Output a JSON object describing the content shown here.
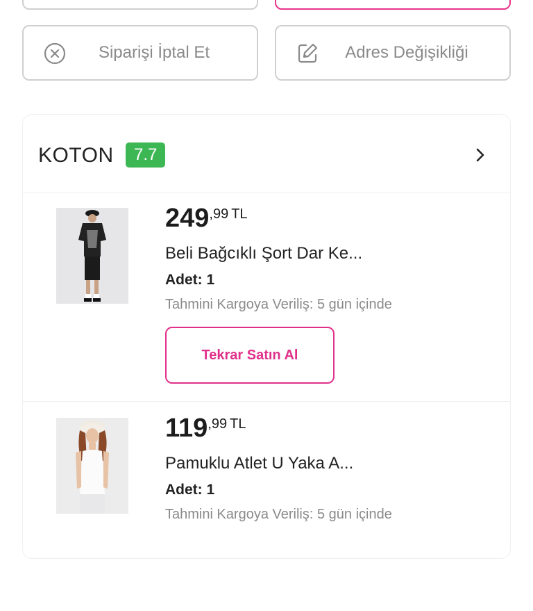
{
  "top_actions": {
    "cancel_order": {
      "label": "Siparişi İptal Et",
      "icon": "circle-x-icon"
    },
    "address_change": {
      "label": "Adres Değişikliği",
      "icon": "edit-icon"
    }
  },
  "seller": {
    "name": "KOTON",
    "score": "7.7",
    "score_color": "#3db754"
  },
  "items": [
    {
      "price_int": "249",
      "price_dec": ",99",
      "currency": "TL",
      "name": "Beli Bağcıklı Şort Dar Ke...",
      "quantity": "Adet: 1",
      "shipping": "Tahmini Kargoya Veriliş: 5 gün içinde",
      "rebuy_label": "Tekrar Satın Al"
    },
    {
      "price_int": "119",
      "price_dec": ",99",
      "currency": "TL",
      "name": "Pamuklu Atlet U Yaka A...",
      "quantity": "Adet: 1",
      "shipping": "Tahmini Kargoya Veriliş: 5 gün içinde"
    }
  ],
  "colors": {
    "accent": "#e0318a",
    "muted": "#8a8a8a"
  }
}
